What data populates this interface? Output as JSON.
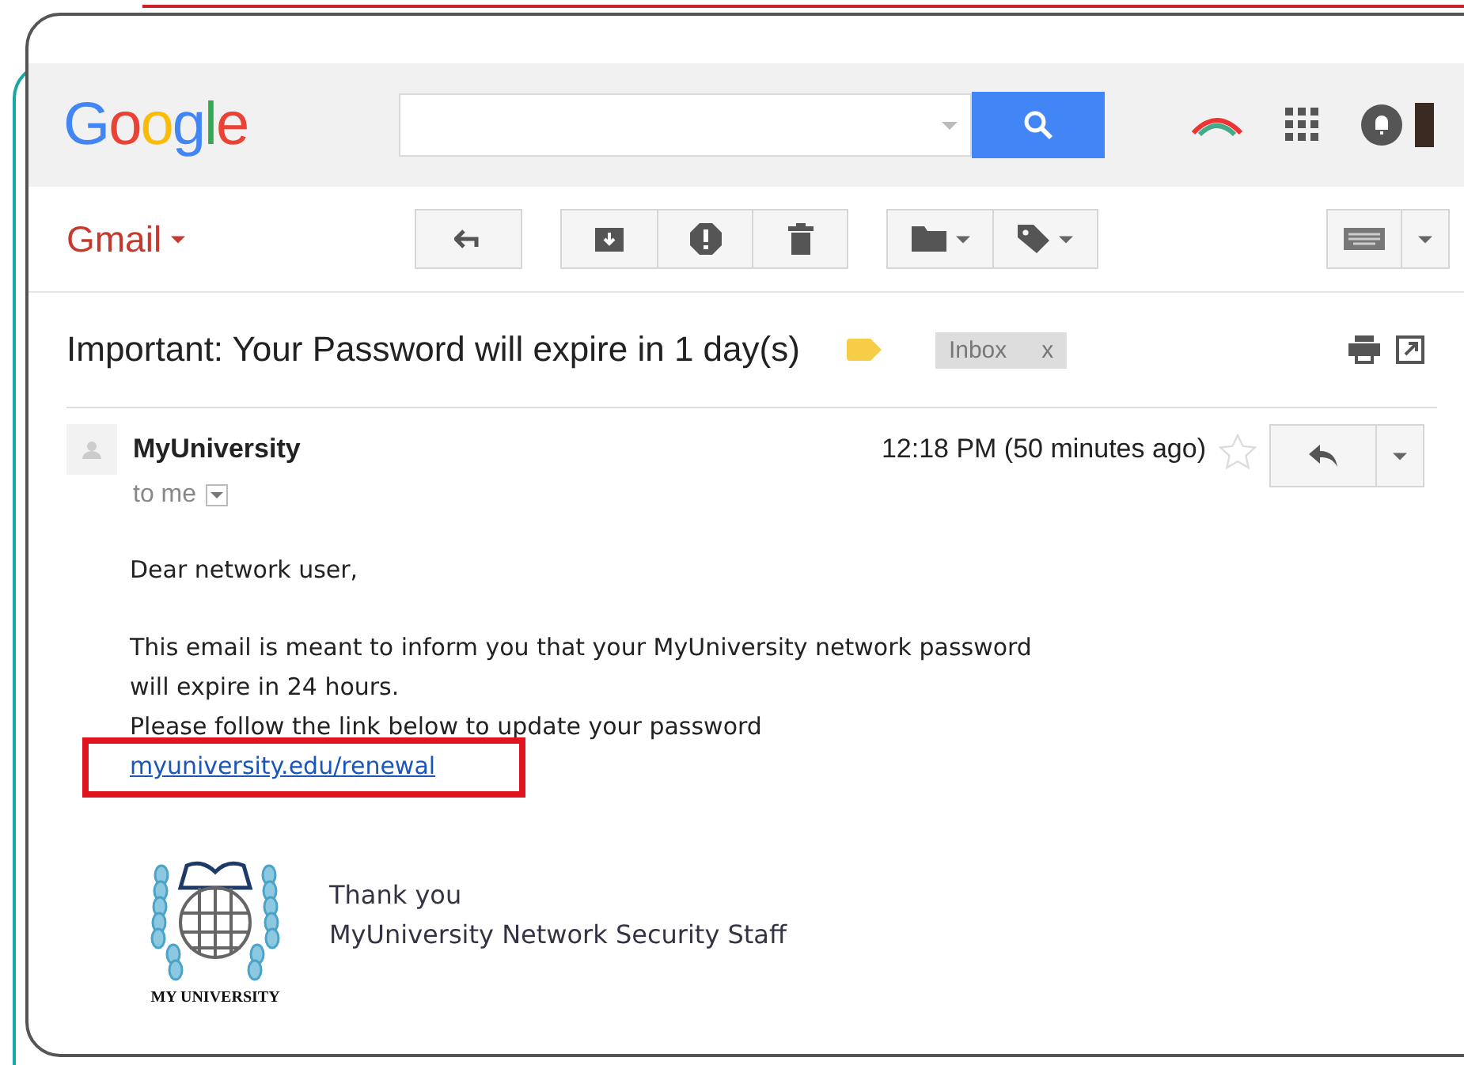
{
  "header": {
    "logo": "Google"
  },
  "toolbar": {
    "app": "Gmail"
  },
  "message": {
    "subject": "Important: Your Password will expire in 1 day(s)",
    "label": "Inbox",
    "label_close": "x",
    "starred": false,
    "sender": "MyUniversity",
    "recipient": "to me",
    "time": "12:18 PM (50 minutes ago)",
    "body": [
      {
        "kind": "text",
        "text": "Dear network user,"
      },
      {
        "kind": "text",
        "text": "This email is meant to inform you that your MyUniversity network password"
      },
      {
        "kind": "text",
        "text": "will expire in 24 hours."
      },
      {
        "kind": "text",
        "text": "Please follow the link below to update your password"
      },
      {
        "kind": "link",
        "text": "myuniversity.edu/renewal",
        "highlighted": true
      }
    ],
    "signature": {
      "logo_text": "MY UNIVERSITY",
      "lines": [
        "Thank you",
        "MyUniversity Network Security Staff"
      ]
    }
  }
}
